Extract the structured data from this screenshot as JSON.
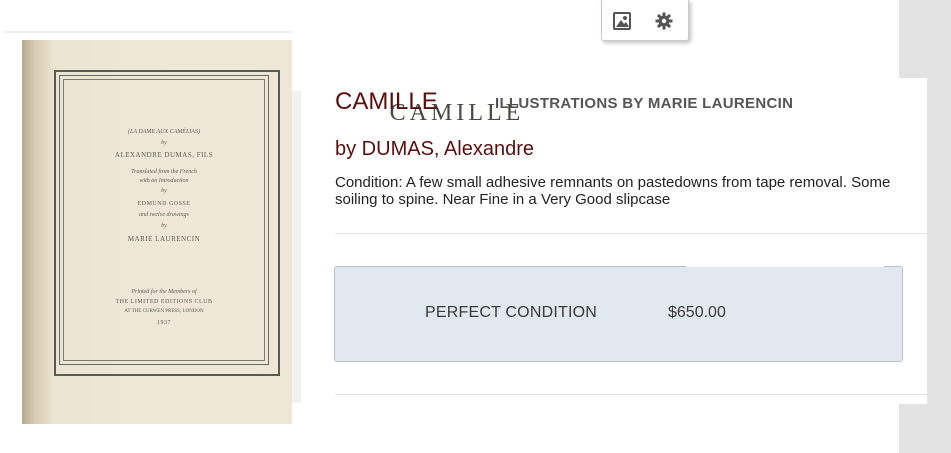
{
  "toolbar": {
    "image_icon": "image-icon",
    "gear_icon": "gear-icon"
  },
  "cover": {
    "title": "CAMILLE",
    "subtitle": "(LA DAME AUX CAMÉLIAS)",
    "by1": "by",
    "author": "ALEXANDRE DUMAS, FILS",
    "translated": "Translated from the French",
    "introduction": "with an Introduction",
    "by2": "by",
    "translator": "EDMUND GOSSE",
    "drawings": "and twelve drawings",
    "by3": "by",
    "illustrator": "MARIE LAURENCIN",
    "printed_for": "Printed for the Members of",
    "club": "THE LIMITED EDITIONS CLUB",
    "press": "AT THE CURWEN PRESS, LONDON",
    "year": "1937"
  },
  "book": {
    "title": "CAMILLE",
    "subtitle": "ILLUSTRATIONS BY MARIE LAURENCIN",
    "author": "by DUMAS, Alexandre",
    "condition": "Condition: A few small adhesive remnants on pastedowns from tape removal. Some soiling to spine. Near Fine in a Very Good slipcase"
  },
  "purchase_option": {
    "label": "PERFECT CONDITION",
    "price": "$650.00"
  }
}
